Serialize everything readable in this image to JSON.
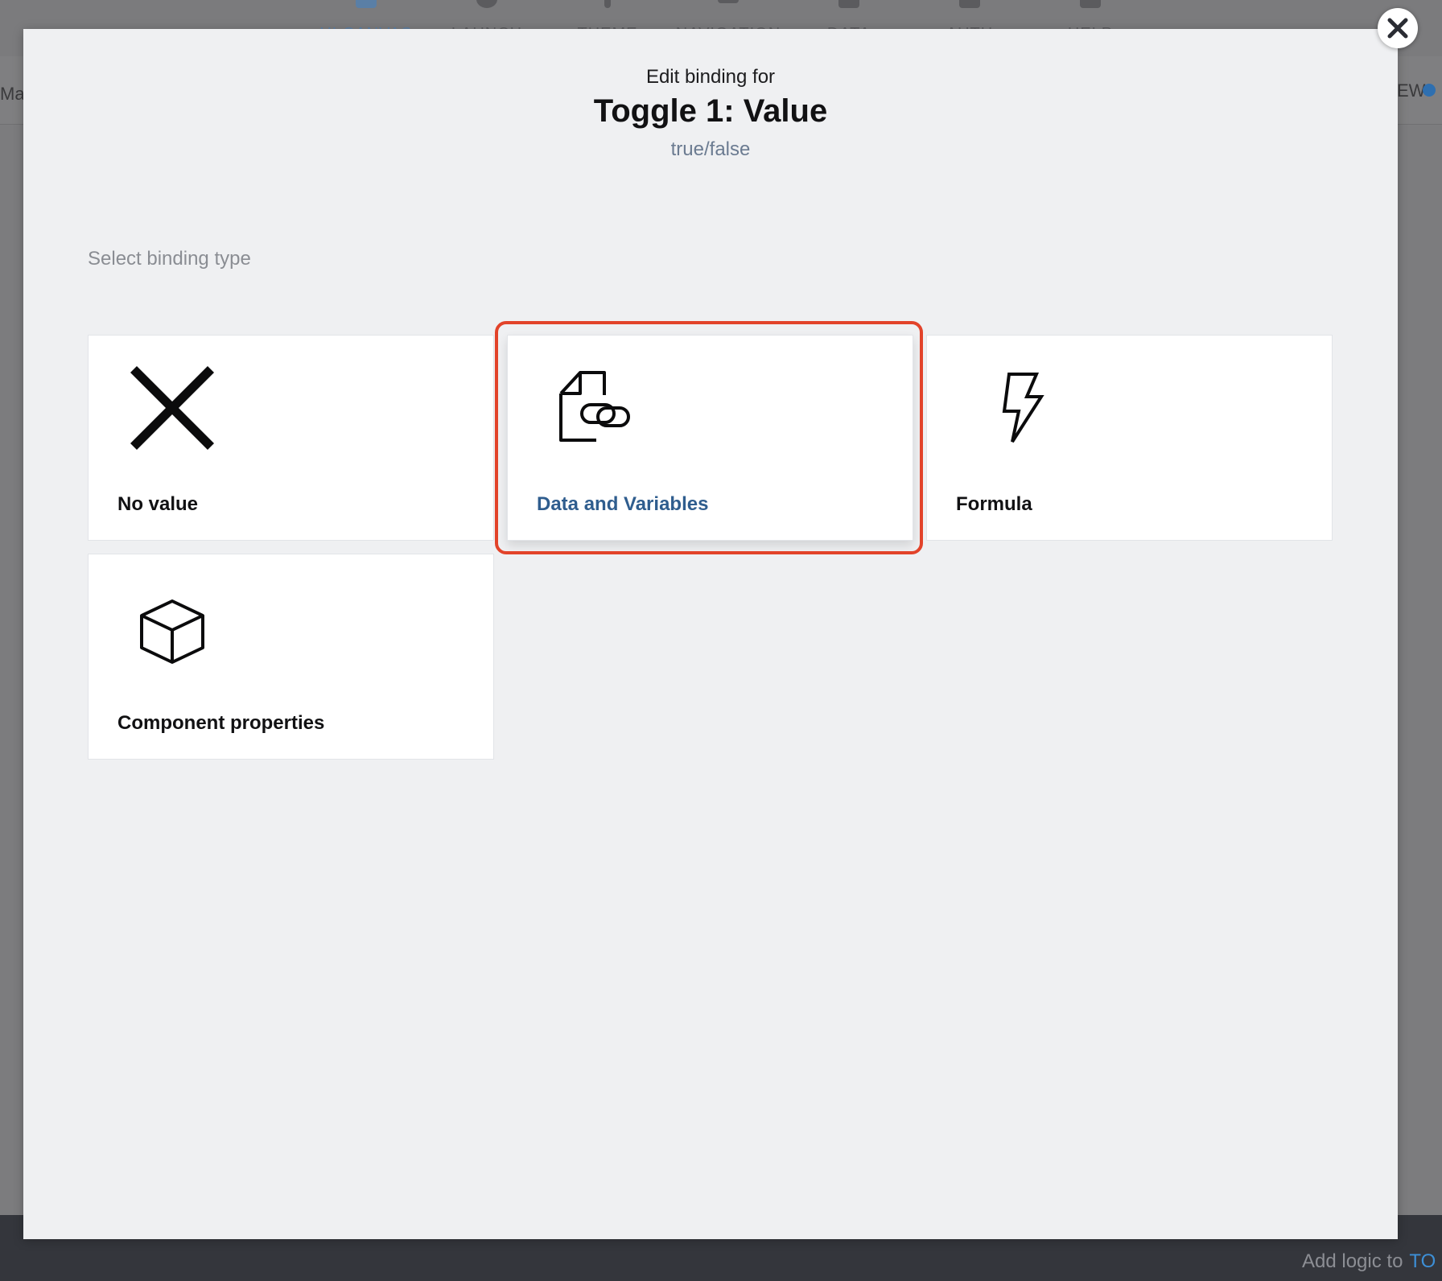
{
  "app": {
    "nav_items": [
      {
        "label": "UI CANVAS",
        "active": true
      },
      {
        "label": "LAUNCH",
        "active": false
      },
      {
        "label": "THEME",
        "active": false
      },
      {
        "label": "NAVIGATION",
        "active": false
      },
      {
        "label": "DATA",
        "active": false
      },
      {
        "label": "AUTH",
        "active": false
      },
      {
        "label": "HELP",
        "active": false
      }
    ],
    "subbar_left_text": "Ma",
    "subbar_right_text": "EW",
    "bottom_text": "Add logic to",
    "bottom_accent_text": "TO"
  },
  "modal": {
    "subtitle": "Edit binding for",
    "title": "Toggle 1: Value",
    "value_type": "true/false",
    "section_label": "Select binding type",
    "close_icon": "close-icon",
    "options": [
      {
        "label": "No value",
        "icon": "x-icon",
        "selected": false
      },
      {
        "label": "Data and Variables",
        "icon": "document-link-icon",
        "selected": true
      },
      {
        "label": "Formula",
        "icon": "lightning-bolt-icon",
        "selected": false
      },
      {
        "label": "Component properties",
        "icon": "cube-icon",
        "selected": false
      }
    ]
  },
  "colors": {
    "selected_label": "#2f5d8e",
    "highlight_ring": "#e2432a",
    "modal_background": "#eff0f2",
    "value_type_text": "#6b7b91"
  }
}
